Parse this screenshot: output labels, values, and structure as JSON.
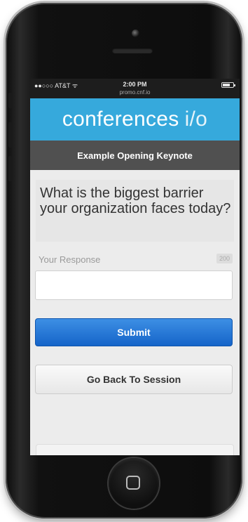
{
  "status_bar": {
    "carrier": "●●○○○ AT&T ᯤ",
    "time": "2:00 PM",
    "url": "promo.cnf.io",
    "battery_icon": "battery-icon"
  },
  "brand": {
    "name": "conferences",
    "suffix": "i/o",
    "color": "#36a9dc"
  },
  "session": {
    "title": "Example Opening Keynote"
  },
  "question": {
    "text": "What is the biggest barrier your organization faces today?"
  },
  "response": {
    "label": "Your Response",
    "char_limit": "200",
    "value": "",
    "placeholder": ""
  },
  "actions": {
    "submit_label": "Submit",
    "back_label": "Go Back To Session"
  },
  "colors": {
    "accent": "#36a9dc",
    "submit": "#1b6fd6",
    "session_bar": "#505050"
  },
  "icons": {
    "home": "home-button-icon",
    "camera": "camera-icon",
    "speaker": "speaker-icon"
  }
}
